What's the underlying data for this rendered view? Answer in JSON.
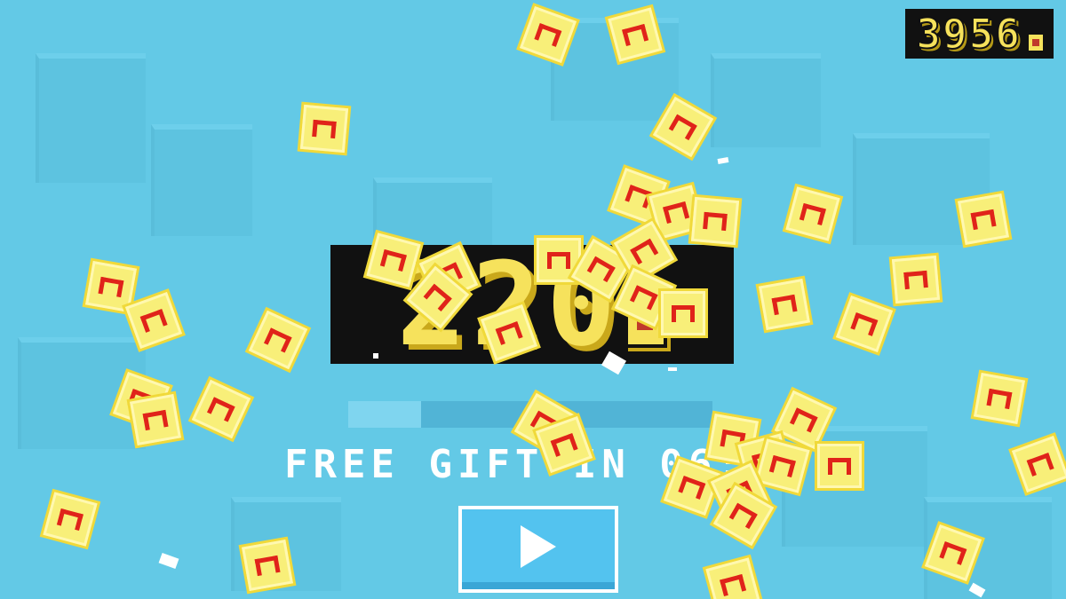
{
  "hud": {
    "coin_total": "3956",
    "coin_icon": "coin-icon"
  },
  "reward": {
    "amount": "220",
    "coin_icon": "coin-icon"
  },
  "gift": {
    "progress": 0.2,
    "text": "FREE GIFT IN 06:"
  },
  "play": {
    "icon": "play-icon"
  },
  "colors": {
    "background": "#63c9e6",
    "coin_yellow": "#f6e25c",
    "coin_mark": "#e0231a",
    "button_blue": "#53c3ef"
  }
}
